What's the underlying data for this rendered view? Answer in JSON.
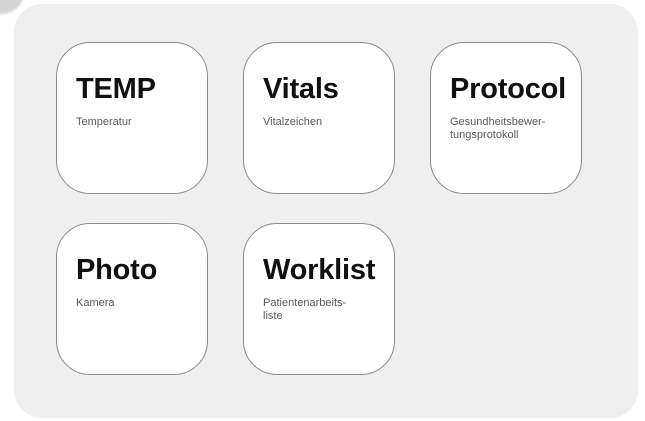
{
  "tiles": [
    {
      "title": "TEMP",
      "subtitle": "Temperatur"
    },
    {
      "title": "Vitals",
      "subtitle": "Vitalzeichen"
    },
    {
      "title": "Protocol",
      "subtitle": "Gesundheitsbewer-\ntungsprotokoll"
    },
    {
      "title": "Photo",
      "subtitle": "Kamera"
    },
    {
      "title": "Worklist",
      "subtitle": "Patientenarbeits-\nliste"
    }
  ]
}
